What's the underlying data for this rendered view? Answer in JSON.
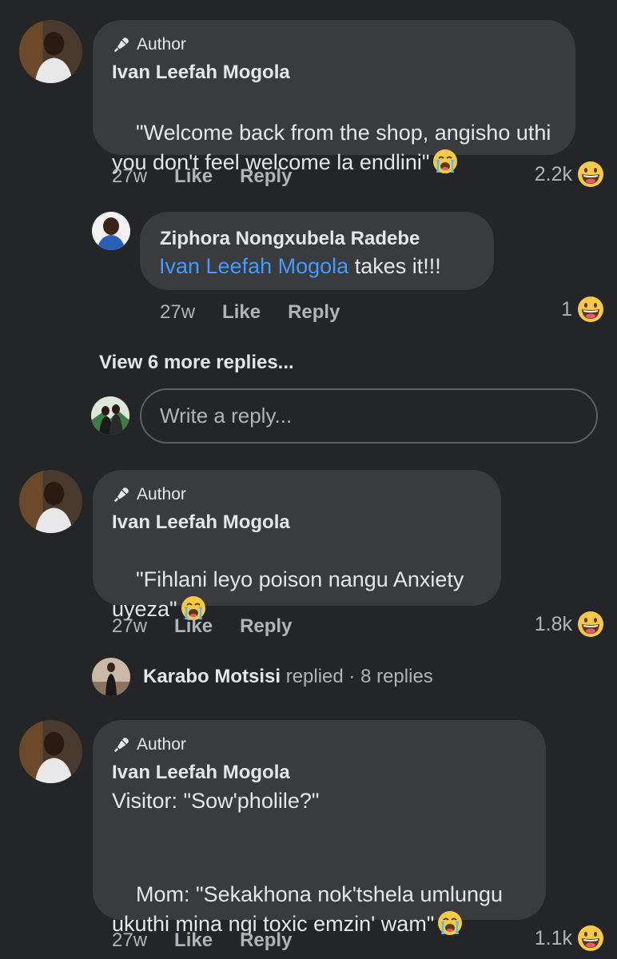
{
  "comments": [
    {
      "badge": "Author",
      "name": "Ivan Leefah Mogola",
      "text": "\"Welcome back from the shop, angisho uthi you don't feel welcome la endlini\"",
      "emoji": "loudly-crying-face",
      "time": "27w",
      "like": "Like",
      "reply": "Reply",
      "reactions": "2.2k",
      "reaction_icon": "laughing-face"
    },
    {
      "badge": "Author",
      "name": "Ivan Leefah Mogola",
      "text": "\"Fihlani leyo poison nangu Anxiety uyeza\"",
      "emoji": "loudly-crying-face",
      "time": "27w",
      "like": "Like",
      "reply": "Reply",
      "reactions": "1.8k",
      "reaction_icon": "laughing-face"
    },
    {
      "badge": "Author",
      "name": "Ivan Leefah Mogola",
      "text_line1": "Visitor: \"Sow'pholile?\"",
      "text_line2": "Mom: \"Sekakhona nok'tshela umlungu ukuthi mina ngi toxic emzin' wam\"",
      "emoji": "loudly-crying-face",
      "time": "27w",
      "like": "Like",
      "reply": "Reply",
      "reactions": "1.1k",
      "reaction_icon": "laughing-face"
    }
  ],
  "reply1": {
    "name": "Ziphora Nongxubela Radebe",
    "mention": "Ivan Leefah Mogola",
    "text": " takes it!!!",
    "time": "27w",
    "like": "Like",
    "reply": "Reply",
    "reactions": "1",
    "reaction_icon": "laughing-face"
  },
  "view_more": "View 6 more replies...",
  "reply_box": {
    "placeholder": "Write a reply..."
  },
  "replied": {
    "name": "Karabo Motsisi",
    "action": " replied",
    "count": " · 8 replies"
  },
  "colors": {
    "background": "#242526",
    "bubble": "#3a3b3c",
    "mention": "#4599ff",
    "secondary_text": "#b0b3b8"
  }
}
